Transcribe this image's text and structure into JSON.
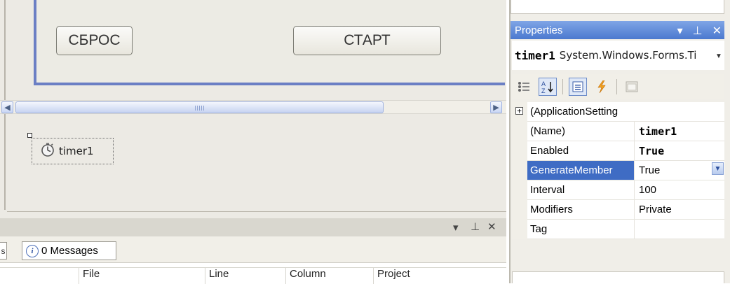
{
  "form": {
    "reset_label": "СБРОС",
    "start_label": "СТАРТ"
  },
  "designer": {
    "scroll_grip": "III",
    "component_tray": {
      "timer_label": "timer1",
      "timer_icon": "stopwatch-icon"
    }
  },
  "error_list": {
    "header_glyphs": {
      "pin": "⊥",
      "close": "✕",
      "menu": "▾"
    },
    "tab_edge_label": "s",
    "messages_label": "0 Messages",
    "info_icon_glyph": "i",
    "columns": [
      "File",
      "Line",
      "Column",
      "Project"
    ]
  },
  "properties": {
    "title": "Properties",
    "title_glyphs": {
      "menu": "▾",
      "pin": "⊥",
      "close": "✕"
    },
    "object_name": "timer1",
    "object_type": "System.Windows.Forms.Ti",
    "toolbar": [
      "categorized-icon",
      "alphabetical-icon",
      "properties-icon",
      "events-icon",
      "property-pages-icon"
    ],
    "category": {
      "expand_glyph": "+",
      "name": "(ApplicationSetting"
    },
    "rows": [
      {
        "name": "(Name)",
        "value": "timer1",
        "bold": true
      },
      {
        "name": "Enabled",
        "value": "True",
        "bold": true
      },
      {
        "name": "GenerateMember",
        "value": "True",
        "bold": false,
        "selected": true
      },
      {
        "name": "Interval",
        "value": "100",
        "bold": false
      },
      {
        "name": "Modifiers",
        "value": "Private",
        "bold": false
      },
      {
        "name": "Tag",
        "value": "",
        "bold": false
      }
    ]
  },
  "colors": {
    "form_border": "#6b7fc4",
    "selection": "#3f6cc4",
    "title_bar": "#4b79cf"
  }
}
